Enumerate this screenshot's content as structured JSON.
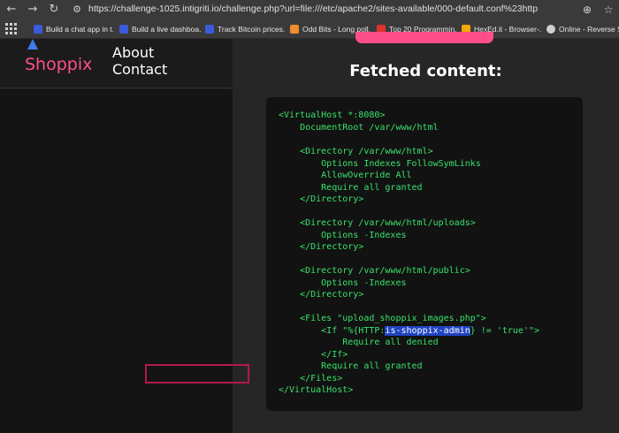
{
  "browser": {
    "url": "https://challenge-1025.intigriti.io/challenge.php?url=file:///etc/apache2/sites-available/000-default.conf%23http",
    "nav_icons": [
      "back-arrow-icon",
      "forward-arrow-icon",
      "reload-icon",
      "site-settings-icon"
    ],
    "bookmarks": [
      {
        "label": "Build a chat app in t...",
        "color": "#3b5bdb"
      },
      {
        "label": "Build a live dashboa...",
        "color": "#3b5bdb"
      },
      {
        "label": "Track Bitcoin prices...",
        "color": "#3b5bdb"
      },
      {
        "label": "Odd Bits - Long poll...",
        "color": "#f08c2c"
      },
      {
        "label": "Top 20 Programmin...",
        "color": "#e03131"
      },
      {
        "label": "HexEd.it - Browser-...",
        "color": "#f2a900"
      },
      {
        "label": "Online - Reverse Sh...",
        "color": "#cfcfcf"
      }
    ]
  },
  "site": {
    "brand": "Shoppix",
    "nav": [
      "About",
      "Contact"
    ],
    "accent_color": "#ff4f8b"
  },
  "main": {
    "heading": "Fetched content:",
    "code_lines": [
      "<VirtualHost *:8080>",
      "    DocumentRoot /var/www/html",
      "",
      "    <Directory /var/www/html>",
      "        Options Indexes FollowSymLinks",
      "        AllowOverride All",
      "        Require all granted",
      "    </Directory>",
      "",
      "    <Directory /var/www/html/uploads>",
      "        Options -Indexes",
      "    </Directory>",
      "",
      "    <Directory /var/www/html/public>",
      "        Options -Indexes",
      "    </Directory>",
      "",
      "    <Files \"upload_shoppix_images.php\">",
      "        <If \"%{HTTP:",
      "            Require all denied",
      "        </If>",
      "        Require all granted",
      "    </Files>",
      "</VirtualHost>"
    ],
    "if_line": {
      "prefix": "        <If \"%{HTTP:",
      "highlight": "is-shoppix-admin",
      "suffix": "} != 'true'\">"
    }
  }
}
